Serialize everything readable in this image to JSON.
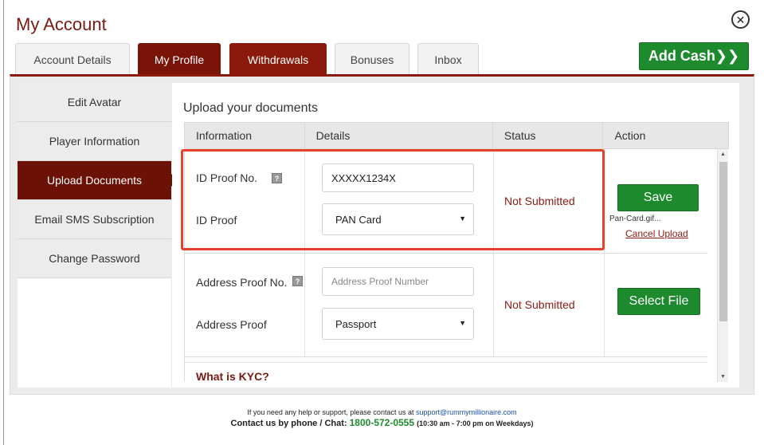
{
  "modal": {
    "title": "My Account",
    "close_symbol": "✕"
  },
  "tabs": [
    {
      "label": "Account Details",
      "state": "inactive"
    },
    {
      "label": "My Profile",
      "state": "active"
    },
    {
      "label": "Withdrawals",
      "state": "highlighted"
    },
    {
      "label": "Bonuses",
      "state": "inactive"
    },
    {
      "label": "Inbox",
      "state": "inactive"
    }
  ],
  "add_cash": {
    "label": "Add Cash❯❯"
  },
  "sidebar": {
    "items": [
      {
        "label": "Edit Avatar"
      },
      {
        "label": "Player Information"
      },
      {
        "label": "Upload Documents",
        "active": true
      },
      {
        "label": "Email SMS Subscription"
      },
      {
        "label": "Change Password"
      }
    ]
  },
  "main": {
    "heading": "Upload your documents",
    "columns": [
      "Information",
      "Details",
      "Status",
      "Action"
    ],
    "rows": [
      {
        "number_label": "ID Proof No.",
        "number_value": "XXXXX1234X",
        "proof_label": "ID Proof",
        "proof_select": "PAN Card",
        "status": "Not Submitted",
        "action_label": "Save",
        "file_name": "Pan-Card.gif...",
        "cancel_label": "Cancel Upload"
      },
      {
        "number_label": "Address Proof No.",
        "number_placeholder": "Address Proof Number",
        "proof_label": "Address Proof",
        "proof_select": "Passport",
        "status": "Not Submitted",
        "action_label": "Select File"
      }
    ],
    "info_icon_text": "?",
    "kyc_link": "What is KYC?"
  },
  "footer": {
    "help_text": "If you need any help or support, please contact us at",
    "email": "support@rummymillionaire.com",
    "contact_label": "Contact us by phone / Chat:",
    "phone": "1800-572-0555",
    "hours": "(10:30 am - 7:00 pm on Weekdays)"
  },
  "colors": {
    "brand": "#7b1a12",
    "accent_green": "#1e8a2e",
    "highlight": "#e8412b"
  }
}
